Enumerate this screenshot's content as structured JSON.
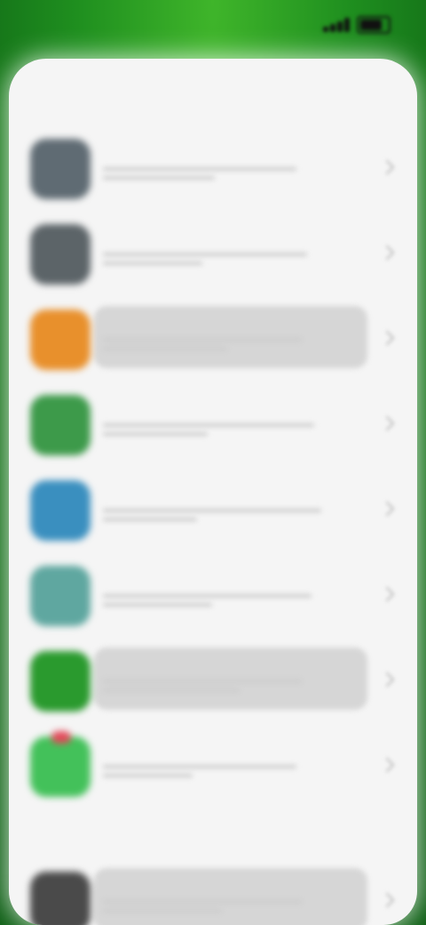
{
  "status": {
    "time": ""
  },
  "sheet": {
    "title": ""
  },
  "apps": [
    {
      "name": "",
      "desc": "",
      "color": "#5f6b73"
    },
    {
      "name": "",
      "desc": "",
      "color": "#5c6468"
    },
    {
      "name": "",
      "desc": "",
      "color": "#e8902c",
      "highlight": true
    },
    {
      "name": "",
      "desc": "",
      "color": "#3d9a4a"
    },
    {
      "name": "",
      "desc": "",
      "color": "#3a8fbf"
    },
    {
      "name": "",
      "desc": "",
      "color": "#5fa7a0"
    },
    {
      "name": "",
      "desc": "",
      "color": "#2a9a2e",
      "highlight": true
    },
    {
      "name": "",
      "desc": "",
      "color": "#43c15a",
      "badge": true
    }
  ],
  "bottom_app": {
    "name": "",
    "desc": "",
    "color": "#4a4a4a",
    "highlight": true
  }
}
